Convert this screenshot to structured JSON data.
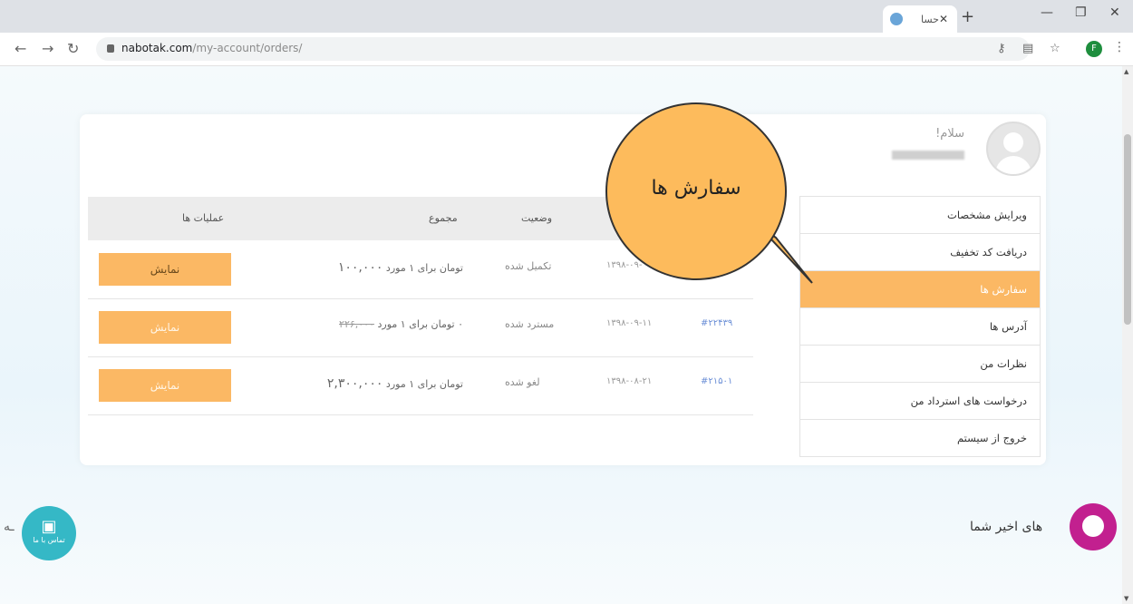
{
  "browser": {
    "tab_title": "حسا",
    "url_domain": "nabotak.com",
    "url_path": "/my-account/orders/",
    "profile_initial": "F"
  },
  "account": {
    "greeting": "سلام!"
  },
  "sidebar": {
    "items": [
      {
        "label": "ویرایش مشخصات"
      },
      {
        "label": "دریافت کد تخفیف"
      },
      {
        "label": "سفارش ها"
      },
      {
        "label": "آدرس ها"
      },
      {
        "label": "نظرات من"
      },
      {
        "label": "درخواست های استرداد من"
      },
      {
        "label": "خروج از سیستم"
      }
    ]
  },
  "orders": {
    "headers": {
      "actions": "عملیات ها",
      "total": "مجموع",
      "status": "وضعیت"
    },
    "rows": [
      {
        "id": "",
        "date": "۱۳۹۸-۰۹-",
        "status": "تکمیل شده",
        "amount": "۱۰۰,۰۰۰",
        "suffix": "تومان برای ۱ مورد",
        "action": "نمایش"
      },
      {
        "id": "#۲۲۴۳۹",
        "date": "۱۳۹۸-۰۹-۱۱",
        "status": "مسترد شده",
        "amount": "۲۲۶,۰۰۰",
        "suffix": "۰ تومان برای ۱ مورد",
        "action": "نمایش"
      },
      {
        "id": "#۲۱۵۰۱",
        "date": "۱۳۹۸-۰۸-۲۱",
        "status": "لغو شده",
        "amount": "۲,۳۰۰,۰۰۰",
        "suffix": "تومان برای ۱ مورد",
        "action": "نمایش"
      }
    ]
  },
  "recent": {
    "title": "های اخیر شما"
  },
  "chat_fab": {
    "label": "تماس با ما"
  },
  "callout": {
    "text": "سفارش ها"
  },
  "colors": {
    "accent": "#fbb864",
    "callout": "#fdbb5c",
    "chat": "#35b8c6",
    "support": "#c2208f"
  }
}
